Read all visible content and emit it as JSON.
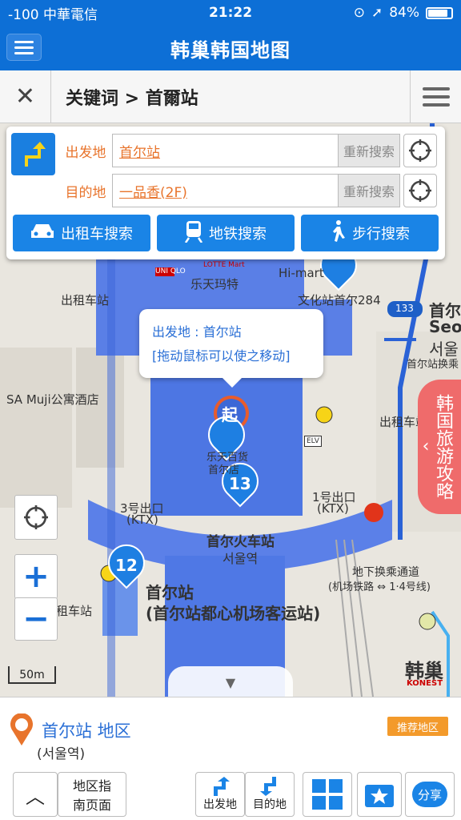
{
  "status": {
    "carrier": "-100 中華電信",
    "time": "21:22",
    "battery": "84%",
    "battery_level": 0.84
  },
  "title": "韩巢韩国地图",
  "search": {
    "crumb": "关键词 > 首爾站"
  },
  "route": {
    "from_label": "出发地",
    "from_value": "首尔站",
    "to_label": "目的地",
    "to_value": "一品香(2F)",
    "research_label": "重新搜索",
    "taxi_label": "出租车搜索",
    "subway_label": "地铁搜索",
    "walk_label": "步行搜索"
  },
  "map": {
    "tooltip_line1": "出发地 : 首尔站",
    "tooltip_line2": "[拖动鼠标可以使之移动]",
    "labels": {
      "lotte_cn": "乐天玛特",
      "himart": "Hi-mart",
      "taxi1": "出租车站",
      "taxi2": "出租车站",
      "taxi3": "租车站",
      "muji": "SA Muji公寓酒店",
      "exit3": "3号出口",
      "exit3b": "(KTX)",
      "exit1": "1号出口",
      "exit1b": "(KTX)",
      "station_cn": "首尔火车站",
      "station_kr": "서울역",
      "station_main": "首尔站",
      "station_sub": "(首尔站都心机场客运站)",
      "transfer": "地下换乘通道",
      "transfer2": "(机场铁路 ⇔ 1·4号线)",
      "wenhua": "文化站首尔284",
      "seoul_kr": "서울",
      "seoul_cn": "首尔",
      "seo": "Seo",
      "transfer_sign": "首尔站换乘",
      "road133": "133",
      "start_marker": "起",
      "pin13": "13",
      "pin12": "12",
      "konest": "韩巢",
      "konest_en": "KONEST",
      "dept": "乐天百货",
      "dept2": "首尔店",
      "scale": "50m",
      "uniqlo": "UNI QLO",
      "lotte_mart": "LOTTE Mart",
      "elev": "ELV"
    },
    "side_tab": "韩国旅游攻略"
  },
  "info": {
    "name": "首尔站 地区",
    "sub": "(서울역)",
    "badge": "推荐地区"
  },
  "toolbar": {
    "region_guide": "地区指南页面",
    "start": "出发地",
    "dest": "目的地",
    "share": "分享"
  },
  "colors": {
    "brand": "#0d6fd6",
    "accent": "#e8742c",
    "tab": "#ef6b6b"
  }
}
